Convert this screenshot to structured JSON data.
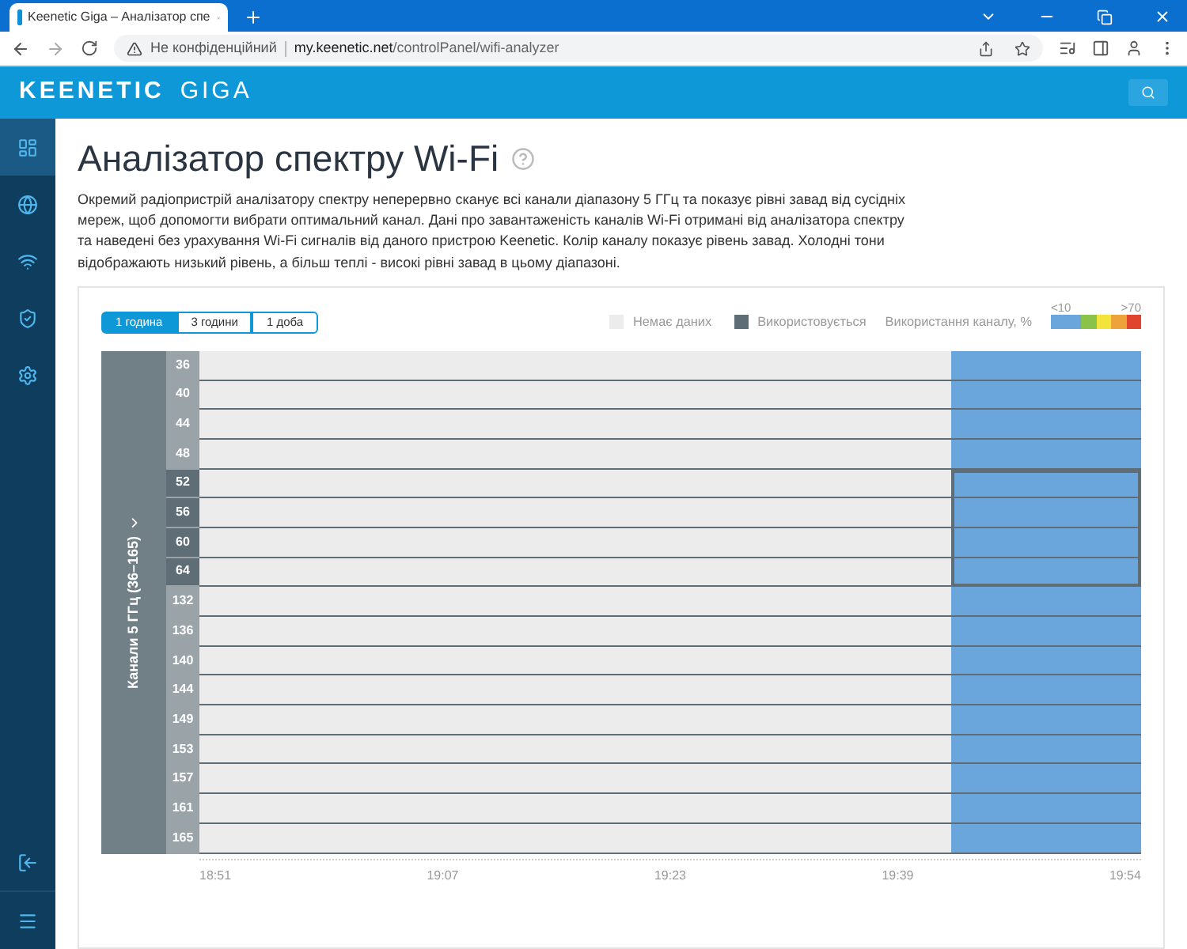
{
  "browser": {
    "tab_title": "Keenetic Giga – Аналізатор спе",
    "security_label": "Не конфіденційний",
    "url_host": "my.keenetic.net",
    "url_path": "/controlPanel/wifi-analyzer"
  },
  "header": {
    "logo": "KEENETIC",
    "model": "GIGA"
  },
  "sidebar": {
    "items": [
      {
        "kind": "dashboard",
        "selected": true
      },
      {
        "kind": "globe",
        "selected": false
      },
      {
        "kind": "wifi",
        "selected": false
      },
      {
        "kind": "shield",
        "selected": false
      },
      {
        "kind": "settings",
        "selected": false
      }
    ]
  },
  "page": {
    "title": "Аналізатор спектру Wi-Fi",
    "description": "Окремий радіопристрій аналізатору спектру неперервно сканує всі канали діапазону 5 ГГц та показує рівні завад від сусідніх мереж, щоб допомогти вибрати оптимальний канал. Дані про завантаженість каналів Wi-Fi отримані від аналізатора спектру та наведені без урахування Wi-Fi сигналів від даного пристрою Keenetic. Колір каналу показує рівень завад. Холодні тони відображають низький рівень, а більш теплі - високі рівні завад в цьому діапазоні."
  },
  "time_ranges": [
    {
      "label": "1 година",
      "selected": true
    },
    {
      "label": "3 години",
      "selected": false
    },
    {
      "label": "1 доба",
      "selected": false
    }
  ],
  "legend": {
    "no_data": "Немає даних",
    "in_use": "Використовується",
    "usage": "Використання каналу, %",
    "low": "<10",
    "high": ">70"
  },
  "band_label": "Канали 5 ГГц (36–165)",
  "channels": [
    {
      "label": "36",
      "in_use": false
    },
    {
      "label": "40",
      "in_use": false
    },
    {
      "label": "44",
      "in_use": false
    },
    {
      "label": "48",
      "in_use": false
    },
    {
      "label": "52",
      "in_use": true
    },
    {
      "label": "56",
      "in_use": true
    },
    {
      "label": "60",
      "in_use": true
    },
    {
      "label": "64",
      "in_use": true
    },
    {
      "label": "132",
      "in_use": false
    },
    {
      "label": "136",
      "in_use": false
    },
    {
      "label": "140",
      "in_use": false
    },
    {
      "label": "144",
      "in_use": false
    },
    {
      "label": "149",
      "in_use": false
    },
    {
      "label": "153",
      "in_use": false
    },
    {
      "label": "157",
      "in_use": false
    },
    {
      "label": "161",
      "in_use": false
    },
    {
      "label": "165",
      "in_use": false
    }
  ],
  "time_labels": [
    "18:51",
    "19:07",
    "19:23",
    "19:39",
    "19:54"
  ]
}
